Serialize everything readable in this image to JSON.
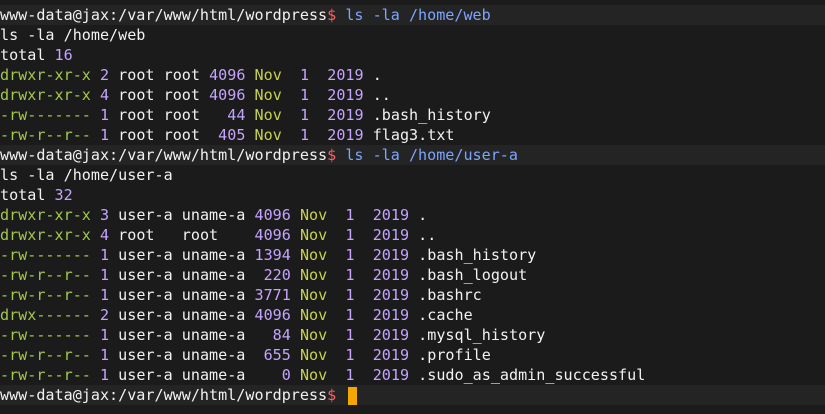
{
  "colors": {
    "background": "#1b1b1b",
    "prompt_sigil": "#ff5f5f",
    "command": "#7aa6ff",
    "permissions": "#a3c94b",
    "numbers": "#c5a3ff",
    "month": "#c7d34a",
    "cursor": "#f5a700"
  },
  "prompt": {
    "text": "www-data@jax:/var/www/html/wordpress",
    "sigil": "$"
  },
  "block1": {
    "command": "ls -la /home/web",
    "echo": "ls -la /home/web",
    "total_label": "total",
    "total_value": "16",
    "rows": [
      {
        "perm": "drwxr-xr-x",
        "links": "2",
        "owner": "root",
        "group": "root",
        "size": "4096",
        "month": "Nov",
        "day": " 1",
        "year": "2019",
        "name": "."
      },
      {
        "perm": "drwxr-xr-x",
        "links": "4",
        "owner": "root",
        "group": "root",
        "size": "4096",
        "month": "Nov",
        "day": " 1",
        "year": "2019",
        "name": ".."
      },
      {
        "perm": "-rw-------",
        "links": "1",
        "owner": "root",
        "group": "root",
        "size": "  44",
        "month": "Nov",
        "day": " 1",
        "year": "2019",
        "name": ".bash_history"
      },
      {
        "perm": "-rw-r--r--",
        "links": "1",
        "owner": "root",
        "group": "root",
        "size": " 405",
        "month": "Nov",
        "day": " 1",
        "year": "2019",
        "name": "flag3.txt"
      }
    ]
  },
  "block2": {
    "command": "ls -la /home/user-a",
    "echo": "ls -la /home/user-a",
    "total_label": "total",
    "total_value": "32",
    "rows": [
      {
        "perm": "drwxr-xr-x",
        "links": "3",
        "owner": "user-a",
        "group": "uname-a",
        "size": "4096",
        "month": "Nov",
        "day": " 1",
        "year": "2019",
        "name": "."
      },
      {
        "perm": "drwxr-xr-x",
        "links": "4",
        "owner": "root  ",
        "group": "root   ",
        "size": "4096",
        "month": "Nov",
        "day": " 1",
        "year": "2019",
        "name": ".."
      },
      {
        "perm": "-rw-------",
        "links": "1",
        "owner": "user-a",
        "group": "uname-a",
        "size": "1394",
        "month": "Nov",
        "day": " 1",
        "year": "2019",
        "name": ".bash_history"
      },
      {
        "perm": "-rw-r--r--",
        "links": "1",
        "owner": "user-a",
        "group": "uname-a",
        "size": " 220",
        "month": "Nov",
        "day": " 1",
        "year": "2019",
        "name": ".bash_logout"
      },
      {
        "perm": "-rw-r--r--",
        "links": "1",
        "owner": "user-a",
        "group": "uname-a",
        "size": "3771",
        "month": "Nov",
        "day": " 1",
        "year": "2019",
        "name": ".bashrc"
      },
      {
        "perm": "drwx------",
        "links": "2",
        "owner": "user-a",
        "group": "uname-a",
        "size": "4096",
        "month": "Nov",
        "day": " 1",
        "year": "2019",
        "name": ".cache"
      },
      {
        "perm": "-rw-------",
        "links": "1",
        "owner": "user-a",
        "group": "uname-a",
        "size": "  84",
        "month": "Nov",
        "day": " 1",
        "year": "2019",
        "name": ".mysql_history"
      },
      {
        "perm": "-rw-r--r--",
        "links": "1",
        "owner": "user-a",
        "group": "uname-a",
        "size": " 655",
        "month": "Nov",
        "day": " 1",
        "year": "2019",
        "name": ".profile"
      },
      {
        "perm": "-rw-r--r--",
        "links": "1",
        "owner": "user-a",
        "group": "uname-a",
        "size": "   0",
        "month": "Nov",
        "day": " 1",
        "year": "2019",
        "name": ".sudo_as_admin_successful"
      }
    ]
  },
  "final": {
    "command": ""
  }
}
